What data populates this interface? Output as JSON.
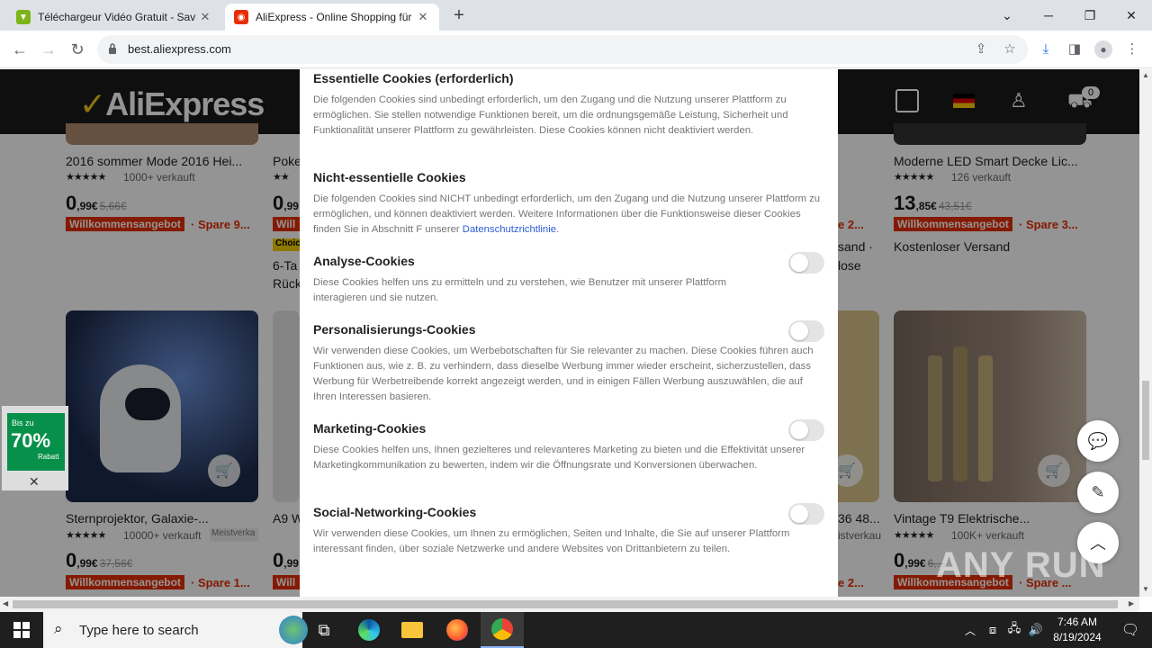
{
  "browser": {
    "tabs": [
      {
        "title": "Téléchargeur Vidéo Gratuit - Sav",
        "active": false
      },
      {
        "title": "AliExpress - Online Shopping für",
        "active": true
      }
    ],
    "url": "best.aliexpress.com"
  },
  "page": {
    "logo": "AliExpress",
    "cart_count": "0",
    "products_top": [
      {
        "title": "2016 sommer Mode 2016 Hei...",
        "sold": "1000+ verkauft",
        "price_int": "0",
        "price_dec": ",99€",
        "old_price": "5,66€",
        "badge": "Willkommensangebot",
        "spare": "· Spare 9..."
      },
      {
        "title": "Poke",
        "price_int": "0",
        "price_dec": ",99",
        "badge": "Will",
        "choice": "Choice",
        "extra1": "6-Ta",
        "extra2": "Rück"
      },
      {
        "title": "Moderne LED Smart Decke Lic...",
        "sold": "126 verkauft",
        "price_int": "13",
        "price_dec": ",85€",
        "old_price": "43,51€",
        "badge": "Willkommensangebot",
        "spare": "· Spare 3...",
        "shipping": "Kostenloser Versand"
      }
    ],
    "products_bottom": [
      {
        "title": "Sternprojektor, Galaxie-...",
        "sold": "10000+ verkauft",
        "tag": "Meistverka",
        "price_int": "0",
        "price_dec": ",99€",
        "old_price": "37,56€",
        "badge": "Willkommensangebot",
        "spare": "· Spare 1..."
      },
      {
        "title": "A9 W",
        "price_int": "0",
        "price_dec": ",99",
        "badge": "Will"
      },
      {
        "title": "Vintage T9 Elektrische...",
        "sold": "100K+ verkauft",
        "price_int": "0",
        "price_dec": ",99€",
        "old_price": "6,...",
        "badge": "Willkommensangebot",
        "spare": "· Spare ..."
      }
    ],
    "partial_right": [
      "sand ·",
      "lose",
      "e 2...",
      "e 2...",
      "36 48...",
      "istverkau"
    ],
    "promo": {
      "line1": "Bis zu",
      "line2": "70%",
      "line3": "Rabatt"
    }
  },
  "modal": {
    "sections": [
      {
        "title": "Essentielle Cookies (erforderlich)",
        "text": "Die folgenden Cookies sind unbedingt erforderlich, um den Zugang und die Nutzung unserer Plattform zu ermöglichen. Sie stellen notwendige Funktionen bereit, um die ordnungsgemäße Leistung, Sicherheit und Funktionalität unserer Plattform zu gewährleisten. Diese Cookies können nicht deaktiviert werden."
      },
      {
        "title": "Nicht-essentielle Cookies",
        "text": "Die folgenden Cookies sind NICHT unbedingt erforderlich, um den Zugang und die Nutzung unserer Plattform zu ermöglichen, und können deaktiviert werden. Weitere Informationen über die Funktionsweise dieser Cookies finden Sie in Abschnitt F unserer ",
        "link": "Datenschutzrichtlinie",
        "after_link": "."
      },
      {
        "title": "Analyse-Cookies",
        "text": "Diese Cookies helfen uns zu ermitteln und zu verstehen, wie Benutzer mit unserer Plattform interagieren und sie nutzen.",
        "enabled": false
      },
      {
        "title": "Personalisierungs-Cookies",
        "text": "Wir verwenden diese Cookies, um Werbebotschaften für Sie relevanter zu machen. Diese Cookies führen auch Funktionen aus, wie z. B. zu verhindern, dass dieselbe Werbung immer wieder erscheint, sicherzustellen, dass Werbung für Werbetreibende korrekt angezeigt werden, und in einigen Fällen Werbung auszuwählen, die auf Ihren Interessen basieren.",
        "enabled": false
      },
      {
        "title": "Marketing-Cookies",
        "text": "Diese Cookies helfen uns, Ihnen gezielteres und relevanteres Marketing zu bieten und die Effektivität unserer Marketingkommunikation zu bewerten, indem wir die Öffnungsrate und Konversionen überwachen.",
        "enabled": false
      },
      {
        "title": "Social-Networking-Cookies",
        "text": "Wir verwenden diese Cookies, um Ihnen zu ermöglichen, Seiten und Inhalte, die Sie auf unserer Plattform interessant finden, über soziale Netzwerke und andere Websites von Drittanbietern zu teilen.",
        "enabled": false
      }
    ]
  },
  "taskbar": {
    "search_placeholder": "Type here to search",
    "time": "7:46 AM",
    "date": "8/19/2024"
  },
  "watermark": "ANY RUN",
  "colors": {
    "accent": "#e62e04",
    "link": "#2a5bd7",
    "logo_yellow": "#f5c518"
  }
}
